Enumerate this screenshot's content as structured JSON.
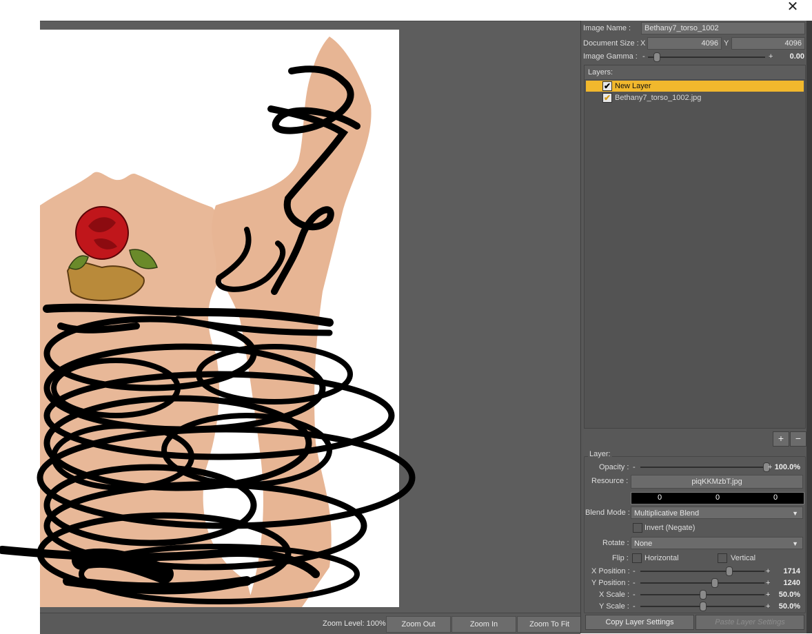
{
  "window": {
    "close_label": "✕"
  },
  "zoom": {
    "level_label": "Zoom Level: 100%",
    "zoom_out": "Zoom Out",
    "zoom_in": "Zoom In",
    "zoom_fit": "Zoom To Fit"
  },
  "image": {
    "name_label": "Image Name :",
    "name_value": "Bethany7_torso_1002",
    "doc_size_label": "Document Size :",
    "x_label": "X",
    "x_value": "4096",
    "y_label": "Y",
    "y_value": "4096",
    "gamma_label": "Image Gamma :",
    "gamma_value": "0.00",
    "gamma_level": 0.05
  },
  "layers": {
    "header": "Layers:",
    "items": [
      {
        "name": "New Layer",
        "checked": true,
        "selected": true
      },
      {
        "name": "Bethany7_torso_1002.jpg",
        "checked": true,
        "selected": false
      }
    ],
    "add": "+",
    "remove": "−"
  },
  "layer": {
    "group_label": "Layer:",
    "opacity_label": "Opacity :",
    "opacity_value": "100.0%",
    "opacity_level": 1.0,
    "resource_label": "Resource :",
    "resource_value": "piqKKMzbT.jpg",
    "color_values": [
      "0",
      "0",
      "0"
    ],
    "blend_label": "Blend Mode :",
    "blend_value": "Multiplicative Blend",
    "invert_label": "Invert (Negate)",
    "rotate_label": "Rotate :",
    "rotate_value": "None",
    "flip_label": "Flip :",
    "flip_h": "Horizontal",
    "flip_v": "Vertical",
    "xpos_label": "X Position :",
    "xpos_value": "1714",
    "xpos_level": 0.72,
    "ypos_label": "Y Position :",
    "ypos_value": "1240",
    "ypos_level": 0.6,
    "xscale_label": "X Scale :",
    "xscale_value": "50.0%",
    "xscale_level": 0.5,
    "yscale_label": "Y Scale :",
    "yscale_value": "50.0%",
    "yscale_level": 0.5
  },
  "buttons": {
    "copy": "Copy Layer Settings",
    "paste": "Paste Layer Settings"
  },
  "icons": {
    "close": "close-icon",
    "check": "checkmark-icon",
    "dropdown": "triangle-down-icon"
  }
}
